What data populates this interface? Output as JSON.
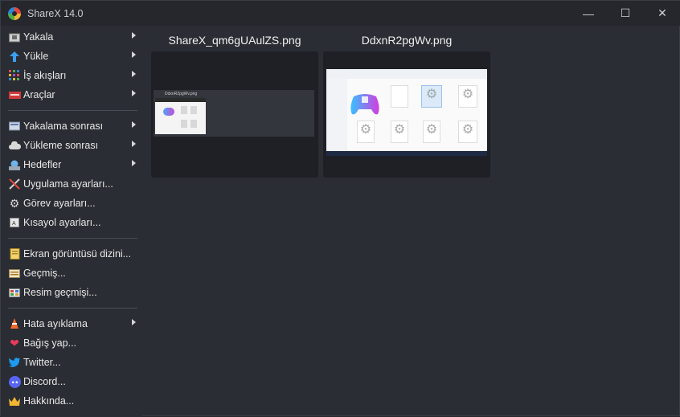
{
  "window": {
    "title": "ShareX 14.0",
    "icon": "sharex-logo-icon"
  },
  "controls": {
    "minimize": "—",
    "maximize": "☐",
    "close": "✕"
  },
  "menu": {
    "group1": [
      {
        "label": "Yakala",
        "icon": "capture-icon",
        "submenu": true
      },
      {
        "label": "Yükle",
        "icon": "upload-arrow-icon",
        "submenu": true
      },
      {
        "label": "İş akışları",
        "icon": "workflows-icon",
        "submenu": true
      },
      {
        "label": "Araçlar",
        "icon": "tools-icon",
        "submenu": true
      }
    ],
    "group2": [
      {
        "label": "Yakalama sonrası",
        "icon": "after-capture-icon",
        "submenu": true
      },
      {
        "label": "Yükleme sonrası",
        "icon": "after-upload-cloud-icon",
        "submenu": true
      },
      {
        "label": "Hedefler",
        "icon": "destinations-icon",
        "submenu": true
      },
      {
        "label": "Uygulama ayarları...",
        "icon": "app-settings-icon",
        "submenu": false
      },
      {
        "label": "Görev ayarları...",
        "icon": "gear-icon",
        "submenu": false
      },
      {
        "label": "Kısayol ayarları...",
        "icon": "hotkey-icon",
        "submenu": false
      }
    ],
    "group3": [
      {
        "label": "Ekran görüntüsü dizini...",
        "icon": "screenshot-folder-icon",
        "submenu": false
      },
      {
        "label": "Geçmiş...",
        "icon": "history-icon",
        "submenu": false
      },
      {
        "label": "Resim geçmişi...",
        "icon": "image-history-icon",
        "submenu": false
      }
    ],
    "group4": [
      {
        "label": "Hata ayıklama",
        "icon": "debug-cone-icon",
        "submenu": true
      },
      {
        "label": "Bağış yap...",
        "icon": "heart-icon",
        "submenu": false
      },
      {
        "label": "Twitter...",
        "icon": "twitter-icon",
        "submenu": false
      },
      {
        "label": "Discord...",
        "icon": "discord-icon",
        "submenu": false
      },
      {
        "label": "Hakkında...",
        "icon": "crown-icon",
        "submenu": false
      }
    ]
  },
  "tiles": [
    {
      "filename": "ShareX_qm6gUAulZS.png",
      "inner_caption": "DdxnR2pgWv.png"
    },
    {
      "filename": "DdxnR2pgWv.png"
    }
  ],
  "colors": {
    "background": "#2a2d33",
    "titlebar": "#25272c",
    "thumb_bg": "#1e2025",
    "text": "#e8e8e8"
  }
}
